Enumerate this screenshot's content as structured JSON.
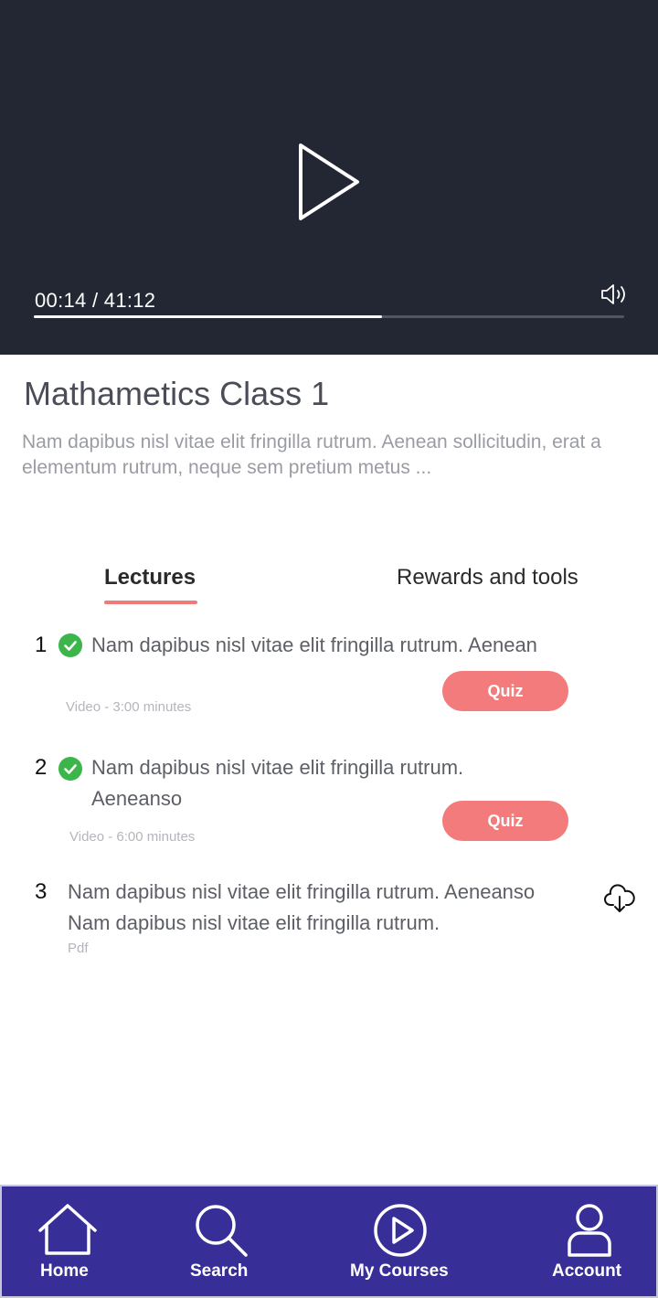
{
  "player": {
    "time_display": "00:14 / 41:12",
    "progress_fraction": 0.59,
    "play_icon": "play-icon",
    "volume_icon": "volume-icon"
  },
  "course": {
    "title": "Mathametics Class 1",
    "description": "Nam dapibus nisl vitae elit fringilla rutrum. Aenean sollicitudin, erat a elementum rutrum, neque sem pretium metus ..."
  },
  "tabs": [
    {
      "label": "Lectures",
      "active": true
    },
    {
      "label": "Rewards and tools",
      "active": false
    }
  ],
  "lectures": [
    {
      "number": "1",
      "completed": true,
      "title": "Nam dapibus nisl vitae elit fringilla rutrum. Aenean",
      "meta": "Video - 3:00 minutes",
      "action": "Quiz"
    },
    {
      "number": "2",
      "completed": true,
      "title": "Nam dapibus nisl vitae elit fringilla rutrum. Aeneanso",
      "meta": "Video - 6:00 minutes",
      "action": "Quiz"
    },
    {
      "number": "3",
      "completed": false,
      "title": "Nam dapibus nisl vitae elit fringilla rutrum. Aeneanso Nam dapibus nisl vitae elit fringilla rutrum.",
      "meta": "Pdf",
      "action_icon": "cloud-download-icon"
    }
  ],
  "bottom_nav": [
    {
      "label": "Home",
      "icon": "home-icon"
    },
    {
      "label": "Search",
      "icon": "search-icon"
    },
    {
      "label": "My Courses",
      "icon": "play-circle-icon"
    },
    {
      "label": "Account",
      "icon": "user-icon"
    }
  ],
  "colors": {
    "player_bg": "#222733",
    "accent": "#f47b7b",
    "check": "#3cb54a",
    "nav_bg": "#372e97"
  }
}
